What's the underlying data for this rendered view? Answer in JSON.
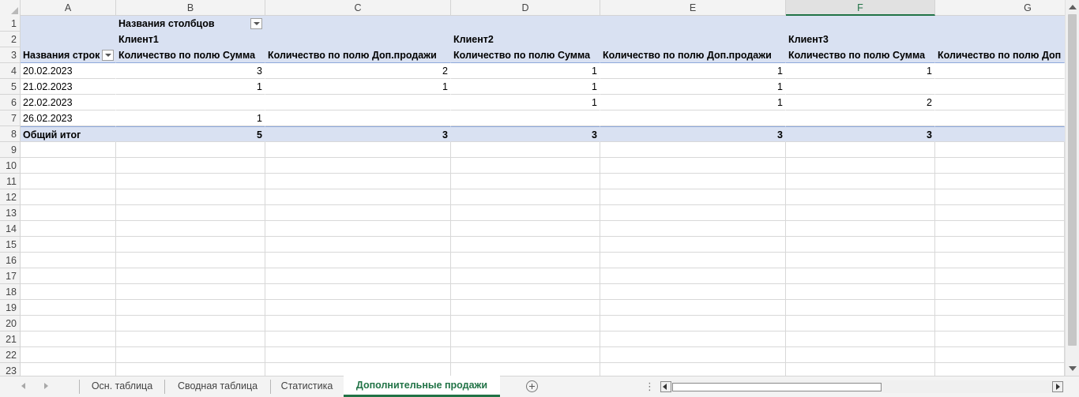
{
  "columns": [
    "A",
    "B",
    "C",
    "D",
    "E",
    "F",
    "G"
  ],
  "selected_column": "F",
  "row_numbers": [
    "1",
    "2",
    "3",
    "4",
    "5",
    "6",
    "7",
    "8",
    "9",
    "10",
    "11",
    "12",
    "13",
    "14",
    "15",
    "16",
    "17",
    "18",
    "19",
    "20",
    "21",
    "22",
    "23"
  ],
  "pivot": {
    "column_labels_header": "Названия столбцов",
    "row_labels_header": "Названия строк",
    "clients": [
      "Клиент1",
      "Клиент2",
      "Клиент3"
    ],
    "field_sum": "Количество по полю Сумма",
    "field_extra": "Количество по полю Доп.продажи",
    "field_extra_truncated": "Количество по полю Доп",
    "rows": [
      {
        "label": "20.02.2023",
        "values": [
          "3",
          "2",
          "1",
          "1",
          "1"
        ]
      },
      {
        "label": "21.02.2023",
        "values": [
          "1",
          "1",
          "1",
          "1",
          ""
        ]
      },
      {
        "label": "22.02.2023",
        "values": [
          "",
          "",
          "1",
          "1",
          "2"
        ]
      },
      {
        "label": "26.02.2023",
        "values": [
          "1",
          "",
          "",
          "",
          ""
        ]
      }
    ],
    "total_label": "Общий итог",
    "totals": [
      "5",
      "3",
      "3",
      "3",
      "3"
    ]
  },
  "tabs": [
    "Осн. таблица",
    "Сводная таблица",
    "Статистика",
    "Дополнительные продажи"
  ],
  "active_tab": "Дополнительные продажи",
  "icons": {
    "add_sheet": "plus-circle-icon",
    "filter": "dropdown-filter-icon",
    "more": "ellipsis-vertical-icon"
  },
  "colors": {
    "accent": "#217346",
    "pivot_header_bg": "#d9e1f2",
    "pivot_line": "#8ea9db"
  }
}
